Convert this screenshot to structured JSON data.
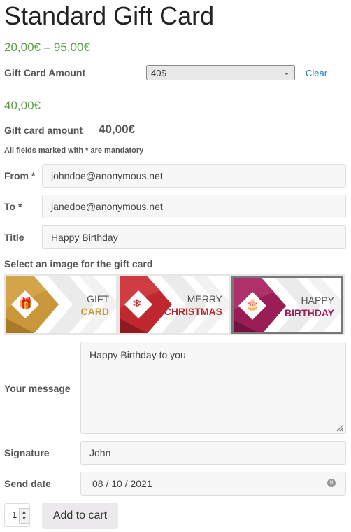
{
  "product": {
    "title": "Standard Gift Card",
    "price_range": "20,00€ – 95,00€"
  },
  "amount_select": {
    "label": "Gift Card Amount",
    "value": "40$",
    "clear_label": "Clear"
  },
  "price": "40,00€",
  "gift_card_amount": {
    "label": "Gift card amount",
    "value": "40,00€"
  },
  "mandatory_note": "All fields marked with * are mandatory",
  "form": {
    "from": {
      "label": "From *",
      "value": "johndoe@anonymous.net"
    },
    "to": {
      "label": "To *",
      "value": "janedoe@anonymous.net"
    },
    "title": {
      "label": "Title",
      "value": "Happy Birthday"
    }
  },
  "image_section": {
    "label": "Select an image for the gift card",
    "cards": [
      {
        "line1": "GIFT",
        "line2": "CARD",
        "color": "#c9963a",
        "icon": "gift-icon"
      },
      {
        "line1": "MERRY",
        "line2": "CHRISTMAS",
        "color": "#c0282f",
        "icon": "ornament-icon"
      },
      {
        "line1": "HAPPY",
        "line2": "BIRTHDAY",
        "color": "#9b1d55",
        "icon": "cake-icon"
      }
    ],
    "selected_index": 2
  },
  "message": {
    "label": "Your message",
    "value": "Happy Birthday to you"
  },
  "signature": {
    "label": "Signature",
    "value": "John"
  },
  "send_date": {
    "label": "Send date",
    "value": "08 / 10 / 2021"
  },
  "quantity": "1",
  "add_to_cart_label": "Add to cart"
}
